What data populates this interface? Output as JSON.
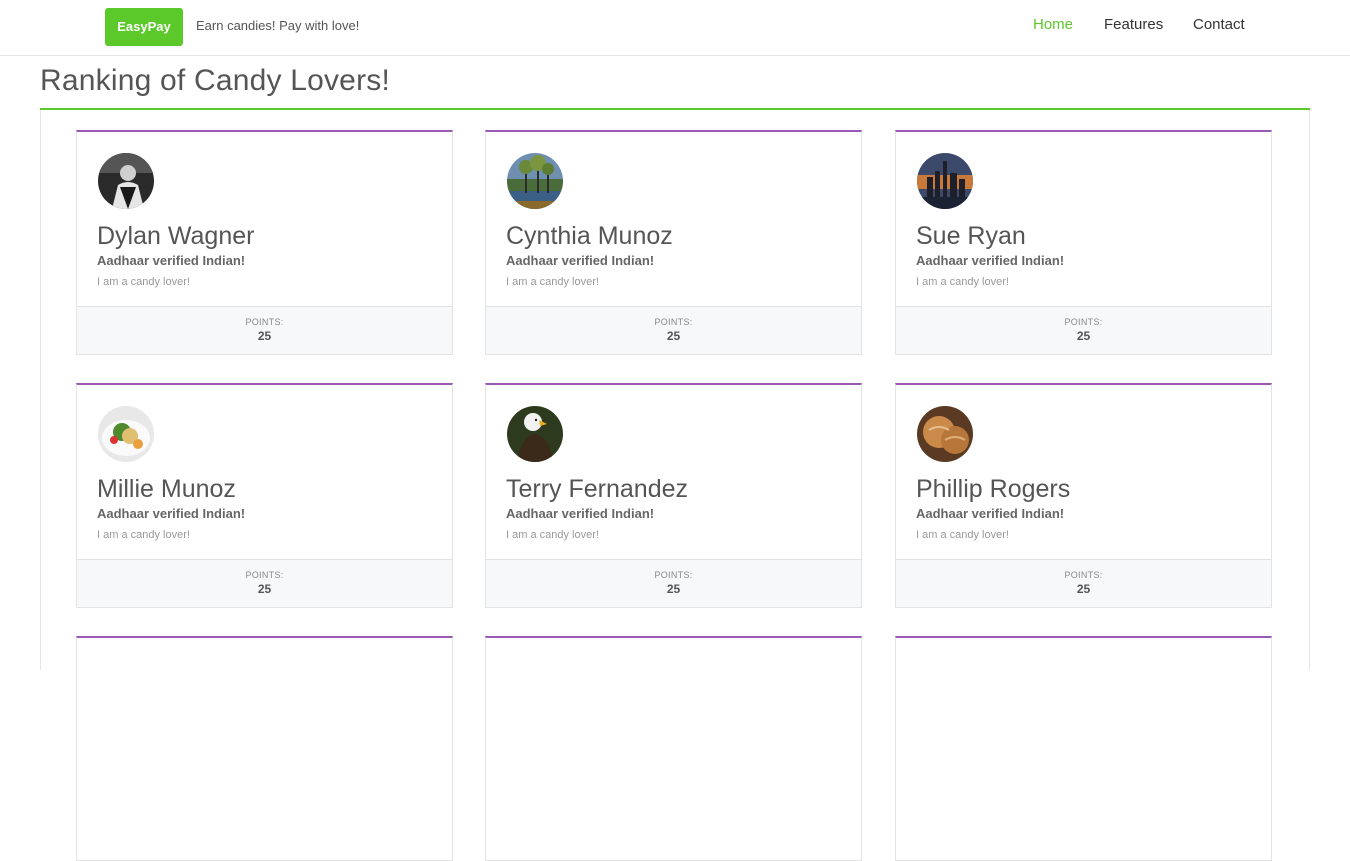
{
  "header": {
    "brand": "EasyPay",
    "tagline": "Earn candies! Pay with love!",
    "nav": [
      {
        "label": "Home",
        "active": true
      },
      {
        "label": "Features",
        "active": false
      },
      {
        "label": "Contact",
        "active": false
      }
    ]
  },
  "page": {
    "title": "Ranking of Candy Lovers!"
  },
  "accent_color": "#5bc92a",
  "card_border_color": "#9b59b6",
  "cards": [
    {
      "name": "Dylan Wagner",
      "subtitle": "Aadhaar verified Indian!",
      "description": "I am a candy lover!",
      "points_label": "POINTS:",
      "points": "25",
      "avatar_icon": "portrait-photo-icon"
    },
    {
      "name": "Cynthia Munoz",
      "subtitle": "Aadhaar verified Indian!",
      "description": "I am a candy lover!",
      "points_label": "POINTS:",
      "points": "25",
      "avatar_icon": "lake-trees-photo-icon"
    },
    {
      "name": "Sue Ryan",
      "subtitle": "Aadhaar verified Indian!",
      "description": "I am a candy lover!",
      "points_label": "POINTS:",
      "points": "25",
      "avatar_icon": "city-skyline-photo-icon"
    },
    {
      "name": "Millie Munoz",
      "subtitle": "Aadhaar verified Indian!",
      "description": "I am a candy lover!",
      "points_label": "POINTS:",
      "points": "25",
      "avatar_icon": "food-plate-photo-icon"
    },
    {
      "name": "Terry Fernandez",
      "subtitle": "Aadhaar verified Indian!",
      "description": "I am a candy lover!",
      "points_label": "POINTS:",
      "points": "25",
      "avatar_icon": "eagle-photo-icon"
    },
    {
      "name": "Phillip Rogers",
      "subtitle": "Aadhaar verified Indian!",
      "description": "I am a candy lover!",
      "points_label": "POINTS:",
      "points": "25",
      "avatar_icon": "bread-photo-icon"
    }
  ]
}
